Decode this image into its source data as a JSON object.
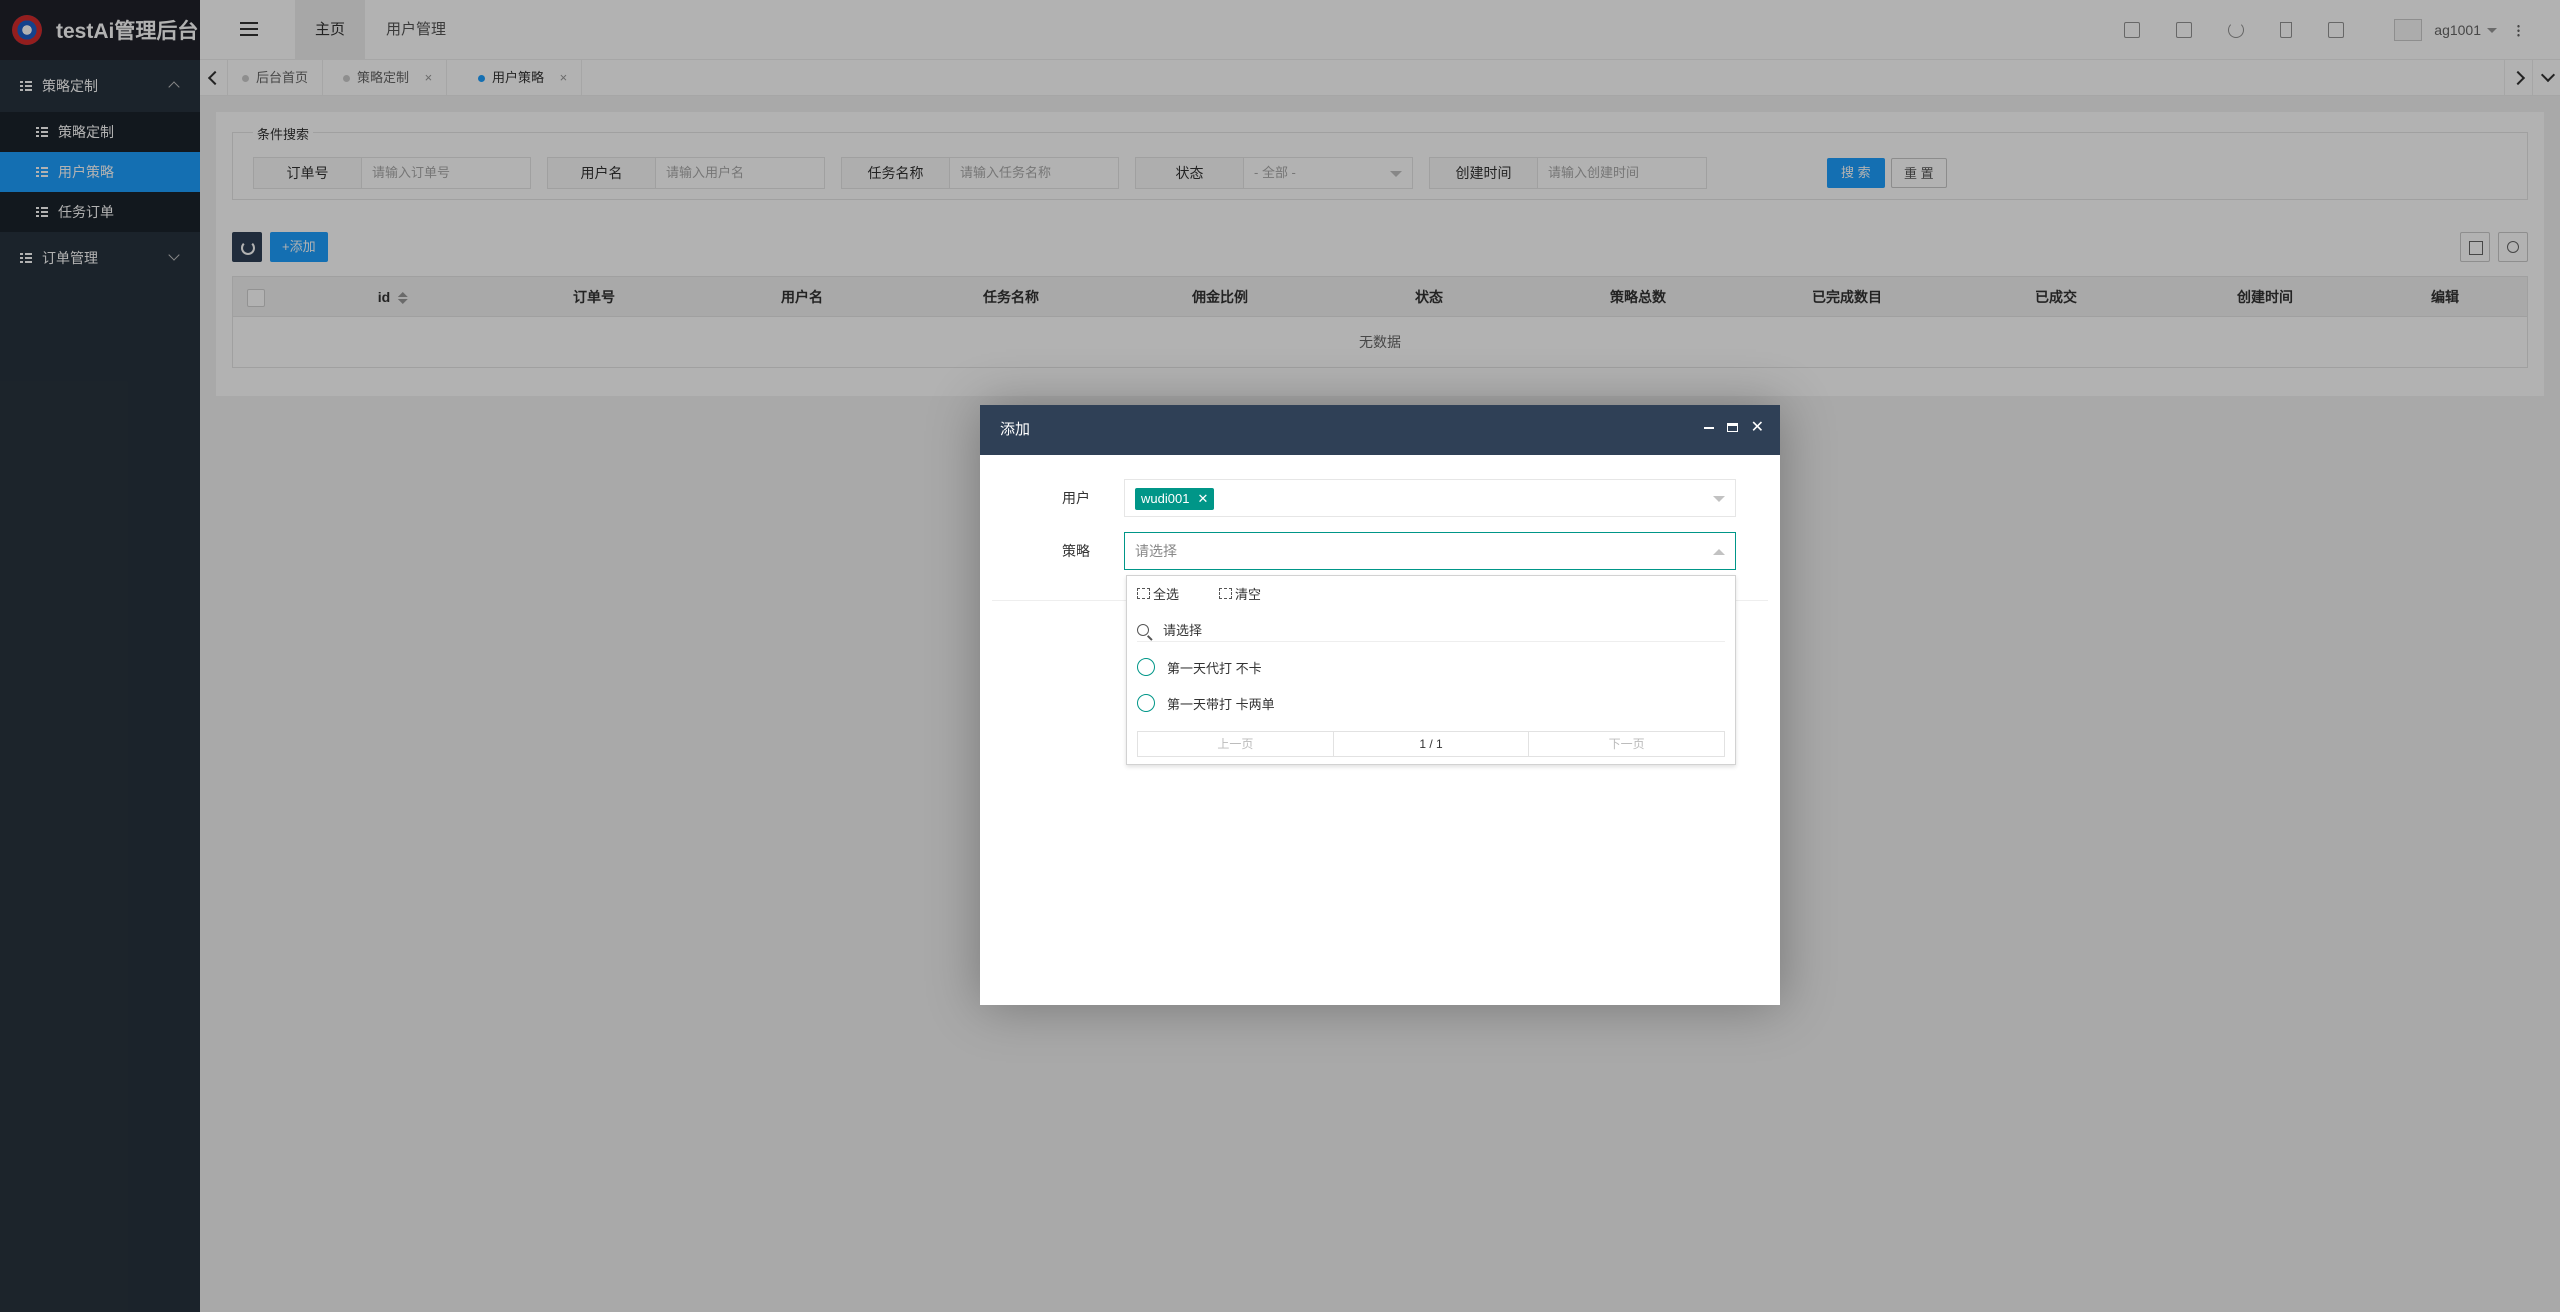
{
  "app": {
    "title": "testAi管理后台"
  },
  "sidebar": {
    "groups": [
      {
        "label": "策略定制",
        "expanded": true,
        "items": [
          {
            "label": "策略定制",
            "active": false
          },
          {
            "label": "用户策略",
            "active": true
          },
          {
            "label": "任务订单",
            "active": false
          }
        ]
      },
      {
        "label": "订单管理",
        "expanded": false,
        "items": []
      }
    ]
  },
  "header": {
    "tabs": [
      {
        "label": "主页"
      },
      {
        "label": "用户管理"
      }
    ],
    "icons": [
      "chart-icon",
      "card-icon",
      "refresh-icon",
      "trash-icon",
      "fullscreen-icon"
    ],
    "user": "ag1001"
  },
  "page_tabs": [
    {
      "label": "后台首页",
      "closable": false,
      "active": false
    },
    {
      "label": "策略定制",
      "closable": true,
      "active": false
    },
    {
      "label": "用户策略",
      "closable": true,
      "active": true
    }
  ],
  "search": {
    "legend": "条件搜索",
    "fields": [
      {
        "label": "订单号",
        "placeholder": "请输入订单号"
      },
      {
        "label": "用户名",
        "placeholder": "请输入用户名"
      },
      {
        "label": "任务名称",
        "placeholder": "请输入任务名称"
      },
      {
        "label": "状态",
        "placeholder": "- 全部 -"
      },
      {
        "label": "创建时间",
        "placeholder": "请输入创建时间"
      }
    ],
    "search_btn": "搜 索",
    "reset_btn": "重 置"
  },
  "toolbar": {
    "add_label": "+添加"
  },
  "table": {
    "columns": [
      "id",
      "订单号",
      "用户名",
      "任务名称",
      "佣金比例",
      "状态",
      "策略总数",
      "已完成数目",
      "已成交",
      "创建时间",
      "编辑"
    ],
    "empty_text": "无数据"
  },
  "modal": {
    "title": "添加",
    "user_label": "用户",
    "user_tag": "wudi001",
    "strategy_label": "策略",
    "strategy_placeholder": "请选择",
    "dropdown": {
      "select_all": "全选",
      "clear": "清空",
      "search_placeholder": "请选择",
      "options": [
        "第一天代打 不卡",
        "第一天带打 卡两单"
      ],
      "prev": "上一页",
      "page": "1 / 1",
      "next": "下一页"
    }
  },
  "colors": {
    "accent": "#1e9fff",
    "sidebar": "#28333e",
    "modal_header": "#2f4056",
    "tag": "#009688"
  }
}
